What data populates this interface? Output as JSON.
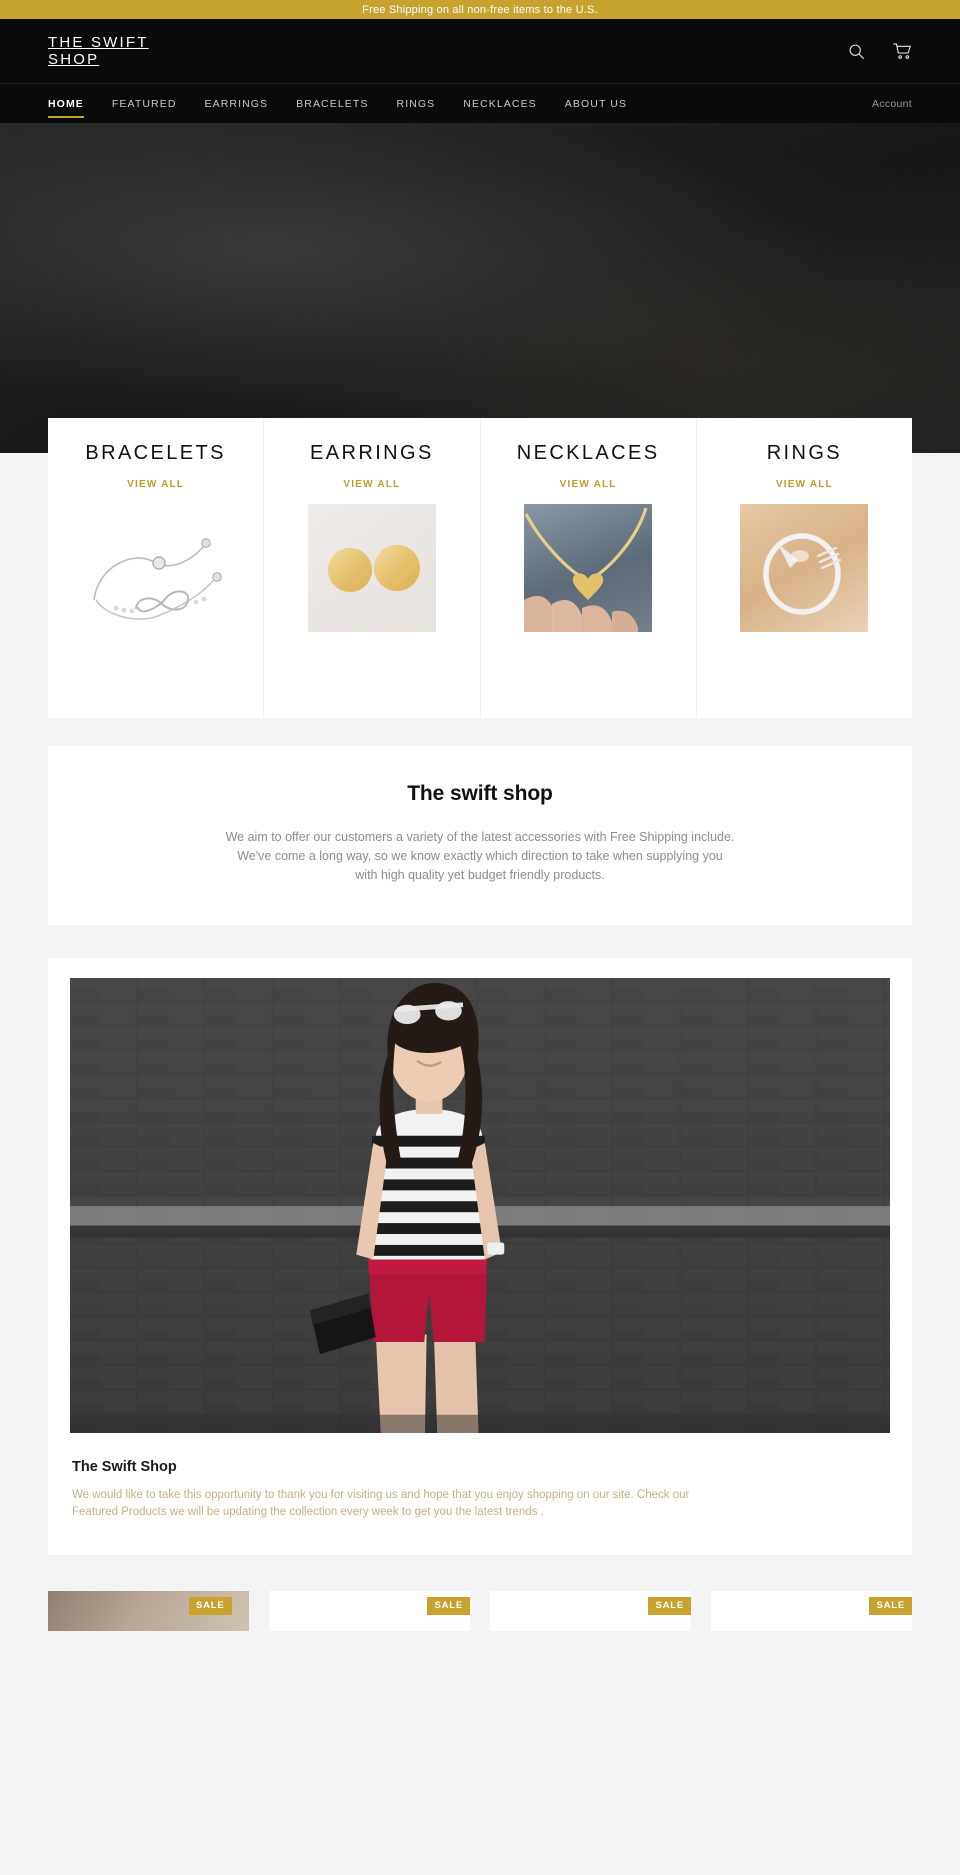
{
  "announcement": {
    "text": "Free Shipping on all non-free items to the U.S."
  },
  "header": {
    "logo": "THE SWIFT SHOP",
    "search_icon": "search-icon",
    "cart_icon": "shopping-cart-icon"
  },
  "nav": {
    "items": [
      {
        "label": "HOME",
        "active": true
      },
      {
        "label": "FEATURED",
        "active": false
      },
      {
        "label": "EARRINGS",
        "active": false
      },
      {
        "label": "BRACELETS",
        "active": false
      },
      {
        "label": "RINGS",
        "active": false
      },
      {
        "label": "NECKLACES",
        "active": false
      },
      {
        "label": "ABOUT US",
        "active": false
      }
    ],
    "account_label": "Account"
  },
  "collections": {
    "view_all_label": "VIEW ALL",
    "items": [
      {
        "title": "BRACELETS",
        "view_all": "VIEW ALL",
        "image": "silver-infinity-bracelet"
      },
      {
        "title": "EARRINGS",
        "view_all": "VIEW ALL",
        "image": "gold-disc-stud-earrings"
      },
      {
        "title": "NECKLACES",
        "view_all": "VIEW ALL",
        "image": "gold-heart-pendant-necklace"
      },
      {
        "title": "RINGS",
        "view_all": "VIEW ALL",
        "image": "silver-arrow-ring"
      }
    ]
  },
  "richtext": {
    "heading": "The swift shop",
    "line1": "We aim to offer our customers a variety of the latest accessories with Free Shipping include.",
    "line2": "We've come a long way, so we know exactly which direction to take when supplying you",
    "line3": "with high quality yet budget friendly products."
  },
  "feature": {
    "image": "woman-in-striped-top-and-red-shorts",
    "title": "The Swift Shop",
    "body": "We would like to take this opportunity to thank you for visiting us and hope that you enjoy shopping on our site. Check our Featured Products we will be updating the collection every week to get you the latest trends ."
  },
  "products": {
    "sale_label": "SALE",
    "items": [
      {
        "badge": "SALE"
      },
      {
        "badge": "SALE"
      },
      {
        "badge": "SALE"
      },
      {
        "badge": "SALE"
      }
    ]
  },
  "colors": {
    "accent_gold": "#c8a22e",
    "link_gold": "#bc9d32",
    "header_black": "#0a0a0a",
    "page_bg": "#f4f4f4"
  }
}
